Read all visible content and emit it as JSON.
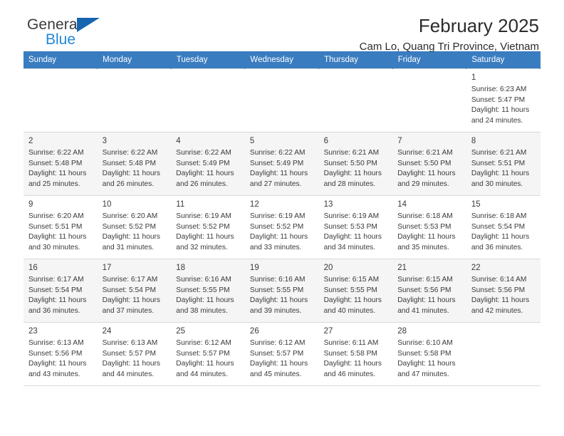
{
  "brand": {
    "name_top": "General",
    "name_bottom": "Blue",
    "accent_color": "#1f87d8",
    "triangle_color": "#1565b0"
  },
  "header": {
    "title": "February 2025",
    "subtitle": "Cam Lo, Quang Tri Province, Vietnam"
  },
  "calendar": {
    "header_bg": "#3a7cc0",
    "weekdays": [
      "Sunday",
      "Monday",
      "Tuesday",
      "Wednesday",
      "Thursday",
      "Friday",
      "Saturday"
    ],
    "weeks": [
      [
        {
          "day": "",
          "empty": true
        },
        {
          "day": "",
          "empty": true
        },
        {
          "day": "",
          "empty": true
        },
        {
          "day": "",
          "empty": true
        },
        {
          "day": "",
          "empty": true
        },
        {
          "day": "",
          "empty": true
        },
        {
          "day": "1",
          "sunrise": "Sunrise: 6:23 AM",
          "sunset": "Sunset: 5:47 PM",
          "daylight": "Daylight: 11 hours and 24 minutes."
        }
      ],
      [
        {
          "day": "2",
          "sunrise": "Sunrise: 6:22 AM",
          "sunset": "Sunset: 5:48 PM",
          "daylight": "Daylight: 11 hours and 25 minutes."
        },
        {
          "day": "3",
          "sunrise": "Sunrise: 6:22 AM",
          "sunset": "Sunset: 5:48 PM",
          "daylight": "Daylight: 11 hours and 26 minutes."
        },
        {
          "day": "4",
          "sunrise": "Sunrise: 6:22 AM",
          "sunset": "Sunset: 5:49 PM",
          "daylight": "Daylight: 11 hours and 26 minutes."
        },
        {
          "day": "5",
          "sunrise": "Sunrise: 6:22 AM",
          "sunset": "Sunset: 5:49 PM",
          "daylight": "Daylight: 11 hours and 27 minutes."
        },
        {
          "day": "6",
          "sunrise": "Sunrise: 6:21 AM",
          "sunset": "Sunset: 5:50 PM",
          "daylight": "Daylight: 11 hours and 28 minutes."
        },
        {
          "day": "7",
          "sunrise": "Sunrise: 6:21 AM",
          "sunset": "Sunset: 5:50 PM",
          "daylight": "Daylight: 11 hours and 29 minutes."
        },
        {
          "day": "8",
          "sunrise": "Sunrise: 6:21 AM",
          "sunset": "Sunset: 5:51 PM",
          "daylight": "Daylight: 11 hours and 30 minutes."
        }
      ],
      [
        {
          "day": "9",
          "sunrise": "Sunrise: 6:20 AM",
          "sunset": "Sunset: 5:51 PM",
          "daylight": "Daylight: 11 hours and 30 minutes."
        },
        {
          "day": "10",
          "sunrise": "Sunrise: 6:20 AM",
          "sunset": "Sunset: 5:52 PM",
          "daylight": "Daylight: 11 hours and 31 minutes."
        },
        {
          "day": "11",
          "sunrise": "Sunrise: 6:19 AM",
          "sunset": "Sunset: 5:52 PM",
          "daylight": "Daylight: 11 hours and 32 minutes."
        },
        {
          "day": "12",
          "sunrise": "Sunrise: 6:19 AM",
          "sunset": "Sunset: 5:52 PM",
          "daylight": "Daylight: 11 hours and 33 minutes."
        },
        {
          "day": "13",
          "sunrise": "Sunrise: 6:19 AM",
          "sunset": "Sunset: 5:53 PM",
          "daylight": "Daylight: 11 hours and 34 minutes."
        },
        {
          "day": "14",
          "sunrise": "Sunrise: 6:18 AM",
          "sunset": "Sunset: 5:53 PM",
          "daylight": "Daylight: 11 hours and 35 minutes."
        },
        {
          "day": "15",
          "sunrise": "Sunrise: 6:18 AM",
          "sunset": "Sunset: 5:54 PM",
          "daylight": "Daylight: 11 hours and 36 minutes."
        }
      ],
      [
        {
          "day": "16",
          "sunrise": "Sunrise: 6:17 AM",
          "sunset": "Sunset: 5:54 PM",
          "daylight": "Daylight: 11 hours and 36 minutes."
        },
        {
          "day": "17",
          "sunrise": "Sunrise: 6:17 AM",
          "sunset": "Sunset: 5:54 PM",
          "daylight": "Daylight: 11 hours and 37 minutes."
        },
        {
          "day": "18",
          "sunrise": "Sunrise: 6:16 AM",
          "sunset": "Sunset: 5:55 PM",
          "daylight": "Daylight: 11 hours and 38 minutes."
        },
        {
          "day": "19",
          "sunrise": "Sunrise: 6:16 AM",
          "sunset": "Sunset: 5:55 PM",
          "daylight": "Daylight: 11 hours and 39 minutes."
        },
        {
          "day": "20",
          "sunrise": "Sunrise: 6:15 AM",
          "sunset": "Sunset: 5:55 PM",
          "daylight": "Daylight: 11 hours and 40 minutes."
        },
        {
          "day": "21",
          "sunrise": "Sunrise: 6:15 AM",
          "sunset": "Sunset: 5:56 PM",
          "daylight": "Daylight: 11 hours and 41 minutes."
        },
        {
          "day": "22",
          "sunrise": "Sunrise: 6:14 AM",
          "sunset": "Sunset: 5:56 PM",
          "daylight": "Daylight: 11 hours and 42 minutes."
        }
      ],
      [
        {
          "day": "23",
          "sunrise": "Sunrise: 6:13 AM",
          "sunset": "Sunset: 5:56 PM",
          "daylight": "Daylight: 11 hours and 43 minutes."
        },
        {
          "day": "24",
          "sunrise": "Sunrise: 6:13 AM",
          "sunset": "Sunset: 5:57 PM",
          "daylight": "Daylight: 11 hours and 44 minutes."
        },
        {
          "day": "25",
          "sunrise": "Sunrise: 6:12 AM",
          "sunset": "Sunset: 5:57 PM",
          "daylight": "Daylight: 11 hours and 44 minutes."
        },
        {
          "day": "26",
          "sunrise": "Sunrise: 6:12 AM",
          "sunset": "Sunset: 5:57 PM",
          "daylight": "Daylight: 11 hours and 45 minutes."
        },
        {
          "day": "27",
          "sunrise": "Sunrise: 6:11 AM",
          "sunset": "Sunset: 5:58 PM",
          "daylight": "Daylight: 11 hours and 46 minutes."
        },
        {
          "day": "28",
          "sunrise": "Sunrise: 6:10 AM",
          "sunset": "Sunset: 5:58 PM",
          "daylight": "Daylight: 11 hours and 47 minutes."
        },
        {
          "day": "",
          "empty": true
        }
      ]
    ]
  }
}
